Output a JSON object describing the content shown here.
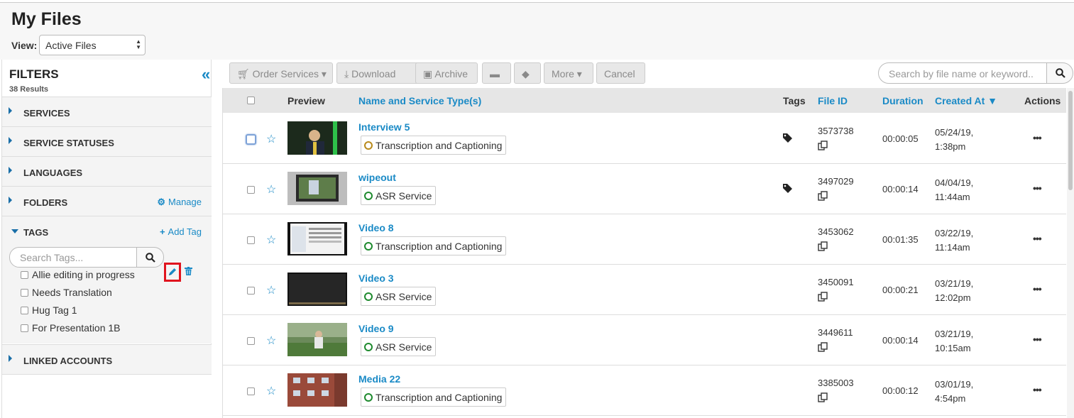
{
  "page": {
    "title": "My Files",
    "view_label": "View:",
    "view_value": "Active Files"
  },
  "sidebar": {
    "title": "FILTERS",
    "results": "38 Results",
    "sections": [
      {
        "label": "SERVICES"
      },
      {
        "label": "SERVICE STATUSES"
      },
      {
        "label": "LANGUAGES"
      },
      {
        "label": "FOLDERS",
        "action": "Manage"
      },
      {
        "label": "TAGS",
        "action": "Add Tag"
      },
      {
        "label": "LINKED ACCOUNTS"
      }
    ],
    "tag_search_placeholder": "Search Tags...",
    "tags": [
      "Allie editing in progress",
      "Needs Translation",
      "Hug Tag 1",
      "For Presentation 1B"
    ]
  },
  "toolbar": {
    "order_services": "Order Services",
    "download": "Download",
    "archive": "Archive",
    "more": "More",
    "cancel": "Cancel",
    "search_placeholder": "Search by file name or keyword.."
  },
  "table": {
    "headers": {
      "preview": "Preview",
      "name": "Name and Service Type(s)",
      "tags": "Tags",
      "file_id": "File ID",
      "duration": "Duration",
      "created": "Created At",
      "actions": "Actions"
    },
    "rows": [
      {
        "name": "Interview 5",
        "service": "Transcription and Captioning",
        "status": "pending",
        "tagged": true,
        "file_id": "3573738",
        "duration": "00:00:05",
        "created_date": "05/24/19,",
        "created_time": "1:38pm"
      },
      {
        "name": "wipeout",
        "service": "ASR Service",
        "status": "complete",
        "tagged": true,
        "file_id": "3497029",
        "duration": "00:00:14",
        "created_date": "04/04/19,",
        "created_time": "11:44am"
      },
      {
        "name": "Video 8",
        "service": "Transcription and Captioning",
        "status": "complete",
        "tagged": false,
        "file_id": "3453062",
        "duration": "00:01:35",
        "created_date": "03/22/19,",
        "created_time": "11:14am"
      },
      {
        "name": "Video 3",
        "service": "ASR Service",
        "status": "complete",
        "tagged": false,
        "file_id": "3450091",
        "duration": "00:00:21",
        "created_date": "03/21/19,",
        "created_time": "12:02pm"
      },
      {
        "name": "Video 9",
        "service": "ASR Service",
        "status": "complete",
        "tagged": false,
        "file_id": "3449611",
        "duration": "00:00:14",
        "created_date": "03/21/19,",
        "created_time": "10:15am"
      },
      {
        "name": "Media 22",
        "service": "Transcription and Captioning",
        "status": "complete",
        "tagged": false,
        "file_id": "3385003",
        "duration": "00:00:12",
        "created_date": "03/01/19,",
        "created_time": "4:54pm"
      }
    ]
  },
  "colors": {
    "accent": "#1a8ac6",
    "complete": "#1e8a2e",
    "pending": "#b88a1c",
    "highlight": "#e0141e"
  }
}
